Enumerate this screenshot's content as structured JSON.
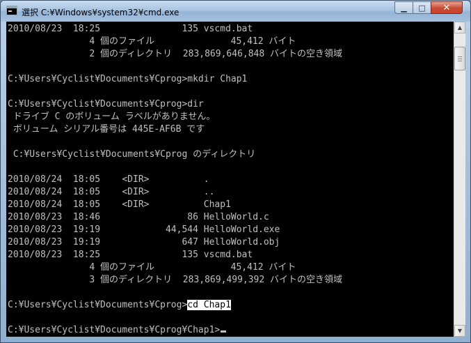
{
  "window": {
    "title": "選択 C:¥Windows¥system32¥cmd.exe",
    "icon": "cmd-console-icon",
    "controls": {
      "minimize": "▁",
      "maximize": "□",
      "close": "✕"
    }
  },
  "console": {
    "lines": [
      "2010/08/23  18:25               135 vscmd.bat",
      "               4 個のファイル              45,412 バイト",
      "               2 個のディレクトリ  283,869,646,848 バイトの空き領域",
      "",
      "C:¥Users¥Cyclist¥Documents¥Cprog>mkdir Chap1",
      "",
      "C:¥Users¥Cyclist¥Documents¥Cprog>dir",
      " ドライブ C のボリューム ラベルがありません。",
      " ボリューム シリアル番号は 445E-AF6B です",
      "",
      " C:¥Users¥Cyclist¥Documents¥Cprog のディレクトリ",
      "",
      "2010/08/24  18:05    <DIR>          .",
      "2010/08/24  18:05    <DIR>          ..",
      "2010/08/24  18:05    <DIR>          Chap1",
      "2010/08/23  18:46                86 HelloWorld.c",
      "2010/08/23  19:19            44,544 HelloWorld.exe",
      "2010/08/23  19:19               647 HelloWorld.obj",
      "2010/08/23  18:25               135 vscmd.bat",
      "               4 個のファイル              45,412 バイト",
      "               3 個のディレクトリ  283,869,499,392 バイトの空き領域",
      "",
      "C:¥Users¥Cyclist¥Documents¥Cprog>",
      "",
      "C:¥Users¥Cyclist¥Documents¥Cprog¥Chap1>"
    ],
    "selected_text": "cd Chap1"
  },
  "scrollbar": {
    "up_arrow": "▲",
    "down_arrow": "▼"
  },
  "colors": {
    "console_bg": "#000000",
    "console_fg": "#c0c0c0",
    "selection_bg": "#ffffff",
    "selection_fg": "#000000",
    "close_button": "#c74a32"
  }
}
